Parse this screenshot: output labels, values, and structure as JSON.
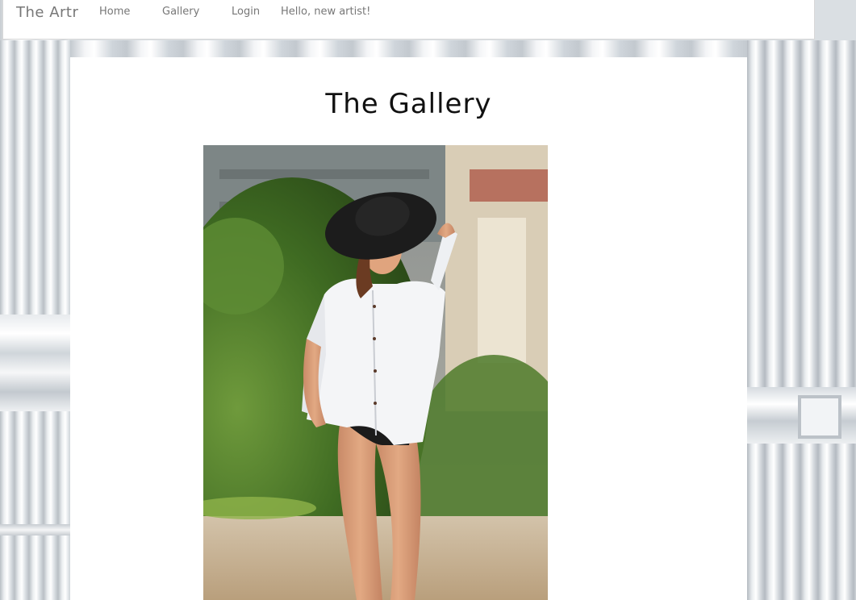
{
  "navbar": {
    "brand": "The Artr",
    "links": {
      "home": "Home",
      "gallery": "Gallery",
      "login": "Login"
    },
    "greeting": "Hello, new artist!"
  },
  "main": {
    "title": "The Gallery",
    "photo": {
      "alt": "Gallery photo"
    }
  },
  "colors": {
    "nav_text": "#777777",
    "title_text": "#111111",
    "panel_bg": "#ffffff"
  }
}
